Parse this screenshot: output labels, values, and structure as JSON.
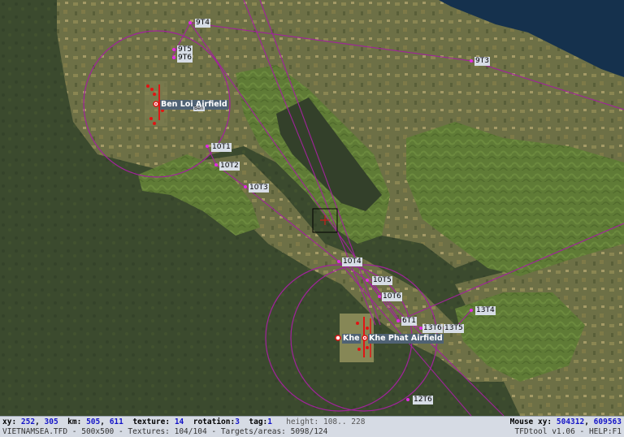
{
  "map": {
    "colors": {
      "jungle": "#3c4b2f",
      "farmland": "#6b7044",
      "hills": "#5c7a33",
      "water": "#15314d",
      "route": "#a0239a",
      "airfield": "#e01515"
    },
    "waypoints": [
      "9T4",
      "9T5",
      "9T6",
      "9T3",
      "10T1",
      "10T2",
      "10T3",
      "10T4",
      "10T5",
      "10T6",
      "6T1",
      "13T6",
      "13T5",
      "13T4",
      "12T6"
    ],
    "airfields": {
      "ben_loi": "Ben Loi Airfield",
      "ben_loi_sub": "Ben",
      "khe": "Khe",
      "khe_phat": "Khe Phat Airfield"
    }
  },
  "status": {
    "xy_label": "xy:",
    "xy_x": "252",
    "xy_y": "305",
    "km_label": "km:",
    "km_x": "505",
    "km_y": "611",
    "texture_label": "texture:",
    "texture": "14",
    "rotation_label": "rotation:",
    "rotation": "3",
    "tag_label": "tag:",
    "tag": "1",
    "height_label": "height:",
    "height": "108.. 228",
    "mouse_label": "Mouse xy:",
    "mouse_x": "504312",
    "mouse_y": "609563",
    "file_info": "VIETNAMSEA.TFD - 500x500 - Textures: 104/104 - Targets/areas: 5098/124",
    "tool_info": "TFDtool v1.06 - HELP:F1"
  }
}
